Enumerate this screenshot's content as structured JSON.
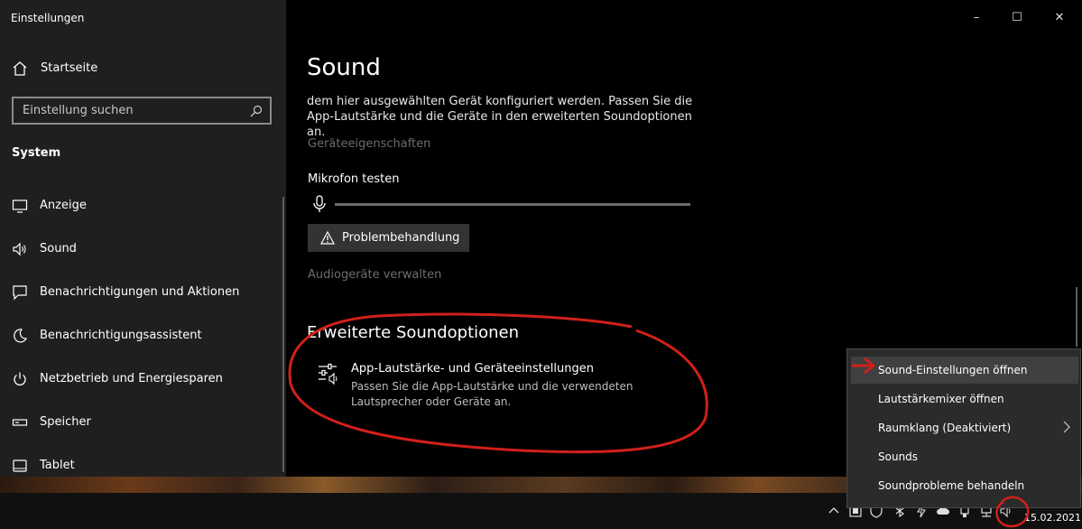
{
  "window": {
    "title": "Einstellungen",
    "controls": [
      "–",
      "☐",
      "✕"
    ]
  },
  "sidebar": {
    "home_label": "Startseite",
    "search_placeholder": "Einstellung suchen",
    "section": "System",
    "items": [
      {
        "label": "Anzeige",
        "icon": "monitor-icon"
      },
      {
        "label": "Sound",
        "icon": "speaker-icon"
      },
      {
        "label": "Benachrichtigungen und Aktionen",
        "icon": "notification-icon"
      },
      {
        "label": "Benachrichtigungsassistent",
        "icon": "moon-icon"
      },
      {
        "label": "Netzbetrieb und Energiesparen",
        "icon": "power-icon"
      },
      {
        "label": "Speicher",
        "icon": "storage-icon"
      },
      {
        "label": "Tablet",
        "icon": "tablet-icon"
      }
    ]
  },
  "main": {
    "title": "Sound",
    "description": "dem hier ausgewählten Gerät konfiguriert werden. Passen Sie die App-Lautstärke und die Geräte in den erweiterten Soundoptionen an.",
    "device_properties": "Geräteeigenschaften",
    "mic_test": "Mikrofon testen",
    "troubleshoot": "Problembehandlung",
    "manage_devices": "Audiogeräte verwalten",
    "advanced_heading": "Erweiterte Soundoptionen",
    "advanced_item_title": "App-Lautstärke- und Geräteeinstellungen",
    "advanced_item_desc": "Passen Sie die App-Lautstärke und die verwendeten Lautsprecher oder Geräte an."
  },
  "context_menu": {
    "items": [
      {
        "label": "Sound-Einstellungen öffnen",
        "highlighted": true
      },
      {
        "label": "Lautstärkemixer öffnen"
      },
      {
        "label": "Raumklang (Deaktiviert)",
        "submenu": true
      },
      {
        "label": "Sounds"
      },
      {
        "label": "Soundprobleme behandeln"
      }
    ]
  },
  "taskbar": {
    "date": "15.02.2021"
  },
  "colors": {
    "annotation_red": "#d0201a",
    "sidebar_bg": "#1f1f1f",
    "menu_bg": "#2b2b2b"
  }
}
